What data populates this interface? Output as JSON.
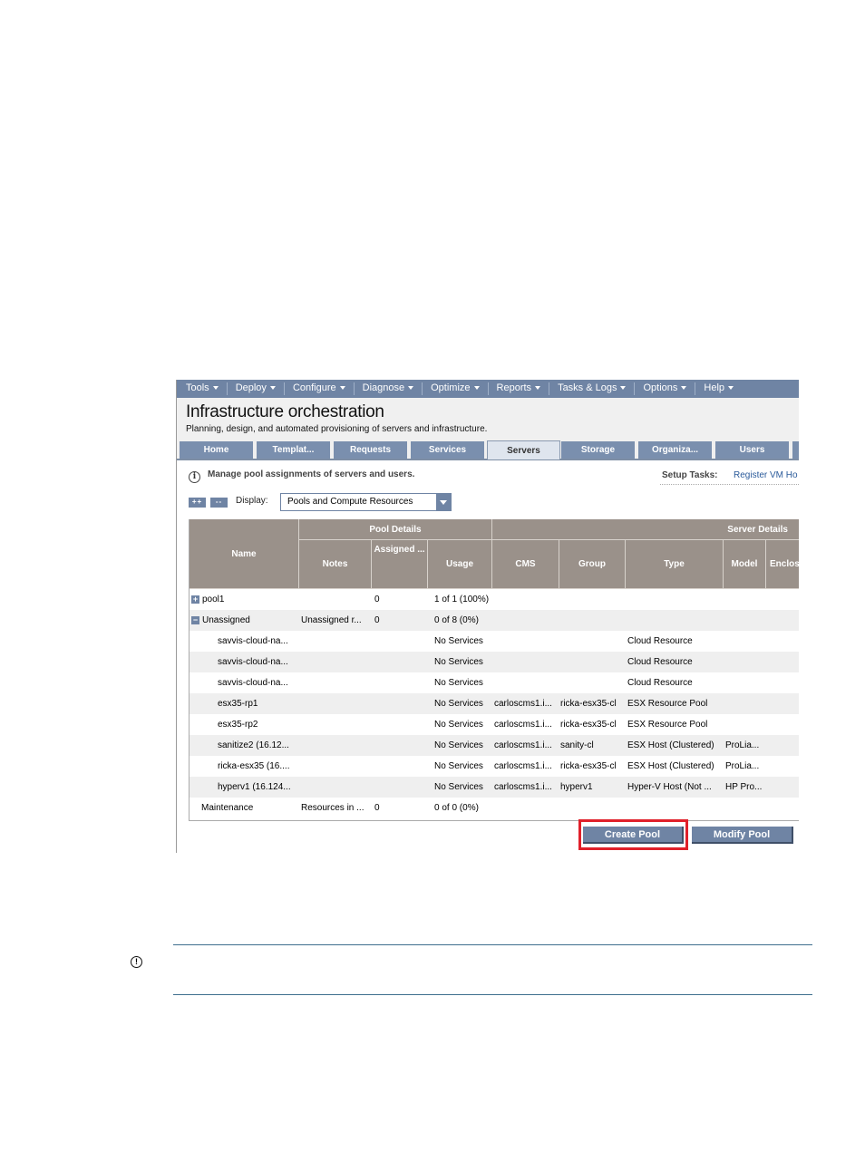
{
  "menubar": {
    "items": [
      "Tools",
      "Deploy",
      "Configure",
      "Diagnose",
      "Optimize",
      "Reports",
      "Tasks & Logs",
      "Options",
      "Help"
    ]
  },
  "header": {
    "title": "Infrastructure orchestration",
    "subtitle": "Planning, design, and automated provisioning of servers and infrastructure."
  },
  "tabs": [
    {
      "label": "Home",
      "active": false
    },
    {
      "label": "Templat...",
      "active": false
    },
    {
      "label": "Requests",
      "active": false
    },
    {
      "label": "Services",
      "active": false
    },
    {
      "label": "Servers",
      "active": true
    },
    {
      "label": "Storage",
      "active": false
    },
    {
      "label": "Organiza...",
      "active": false
    },
    {
      "label": "Users",
      "active": false
    }
  ],
  "info": {
    "icon": "info-icon",
    "text": "Manage pool assignments of servers and users.",
    "setup_label": "Setup Tasks:",
    "setup_link": "Register VM Ho"
  },
  "toolbar": {
    "expand_all": "++",
    "collapse_all": "--",
    "display_label": "Display:",
    "display_value": "Pools and Compute Resources"
  },
  "grid": {
    "group_headers": {
      "pool_details": "Pool Details",
      "server_details": "Server Details"
    },
    "columns": {
      "name": "Name",
      "notes": "Notes",
      "assigned": "Assigned ...",
      "usage": "Usage",
      "cms": "CMS",
      "group": "Group",
      "type": "Type",
      "model": "Model",
      "enclosure": "Enclos"
    },
    "rows": [
      {
        "name": "pool1",
        "expander": "+",
        "notes": "",
        "assigned": "0",
        "usage": "1 of 1 (100%)",
        "cms": "",
        "group": "",
        "type": "",
        "model": ""
      },
      {
        "name": "Unassigned",
        "expander": "−",
        "notes": "Unassigned r...",
        "assigned": "0",
        "usage": "0 of 8 (0%)",
        "cms": "",
        "group": "",
        "type": "",
        "model": ""
      },
      {
        "name": "savvis-cloud-na...",
        "expander": "",
        "notes": "",
        "assigned": "",
        "usage": "No Services",
        "cms": "",
        "group": "",
        "type": "Cloud Resource",
        "model": ""
      },
      {
        "name": "savvis-cloud-na...",
        "expander": "",
        "notes": "",
        "assigned": "",
        "usage": "No Services",
        "cms": "",
        "group": "",
        "type": "Cloud Resource",
        "model": ""
      },
      {
        "name": "savvis-cloud-na...",
        "expander": "",
        "notes": "",
        "assigned": "",
        "usage": "No Services",
        "cms": "",
        "group": "",
        "type": "Cloud Resource",
        "model": ""
      },
      {
        "name": "esx35-rp1",
        "expander": "",
        "notes": "",
        "assigned": "",
        "usage": "No Services",
        "cms": "carloscms1.i...",
        "group": "ricka-esx35-cl",
        "type": "ESX Resource Pool",
        "model": ""
      },
      {
        "name": "esx35-rp2",
        "expander": "",
        "notes": "",
        "assigned": "",
        "usage": "No Services",
        "cms": "carloscms1.i...",
        "group": "ricka-esx35-cl",
        "type": "ESX Resource Pool",
        "model": ""
      },
      {
        "name": "sanitize2 (16.12...",
        "expander": "",
        "notes": "",
        "assigned": "",
        "usage": "No Services",
        "cms": "carloscms1.i...",
        "group": "sanity-cl",
        "type": "ESX Host (Clustered)",
        "model": "ProLia..."
      },
      {
        "name": "ricka-esx35 (16....",
        "expander": "",
        "notes": "",
        "assigned": "",
        "usage": "No Services",
        "cms": "carloscms1.i...",
        "group": "ricka-esx35-cl",
        "type": "ESX Host (Clustered)",
        "model": "ProLia..."
      },
      {
        "name": "hyperv1 (16.124...",
        "expander": "",
        "notes": "",
        "assigned": "",
        "usage": "No Services",
        "cms": "carloscms1.i...",
        "group": "hyperv1",
        "type": "Hyper-V Host (Not ...",
        "model": "HP Pro..."
      },
      {
        "name": "Maintenance",
        "expander": "",
        "notes": "Resources in ...",
        "assigned": "0",
        "usage": "0 of 0 (0%)",
        "cms": "",
        "group": "",
        "type": "",
        "model": ""
      }
    ]
  },
  "actions": {
    "create_pool": "Create Pool",
    "modify_pool": "Modify Pool"
  },
  "colors": {
    "menubar": "#6f84a4",
    "tab": "#7a8fae",
    "grid_header": "#9a918a",
    "highlight": "#e0202a",
    "rule": "#3e6e8e"
  }
}
